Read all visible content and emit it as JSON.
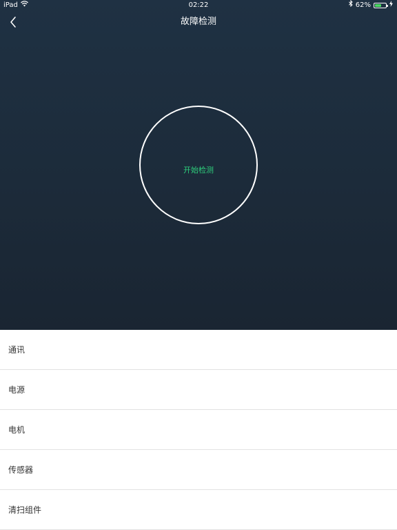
{
  "status_bar": {
    "device": "iPad",
    "time": "02:22",
    "battery_percent": "62%",
    "battery_level": 0.62,
    "icons": [
      "wifi-icon",
      "bluetooth-icon",
      "battery-icon",
      "charging-icon"
    ]
  },
  "nav": {
    "title": "故障检测",
    "back_icon": "chevron-left-icon"
  },
  "detect": {
    "label": "开始检测"
  },
  "list": {
    "items": [
      {
        "label": "通讯"
      },
      {
        "label": "电源"
      },
      {
        "label": "电机"
      },
      {
        "label": "传感器"
      },
      {
        "label": "清扫组件"
      }
    ]
  },
  "colors": {
    "background_top": "#1f3143",
    "background_bottom": "#1a2532",
    "accent_green": "#2ecf7c",
    "battery_green": "#4cd964",
    "divider": "#e2e2e2"
  }
}
